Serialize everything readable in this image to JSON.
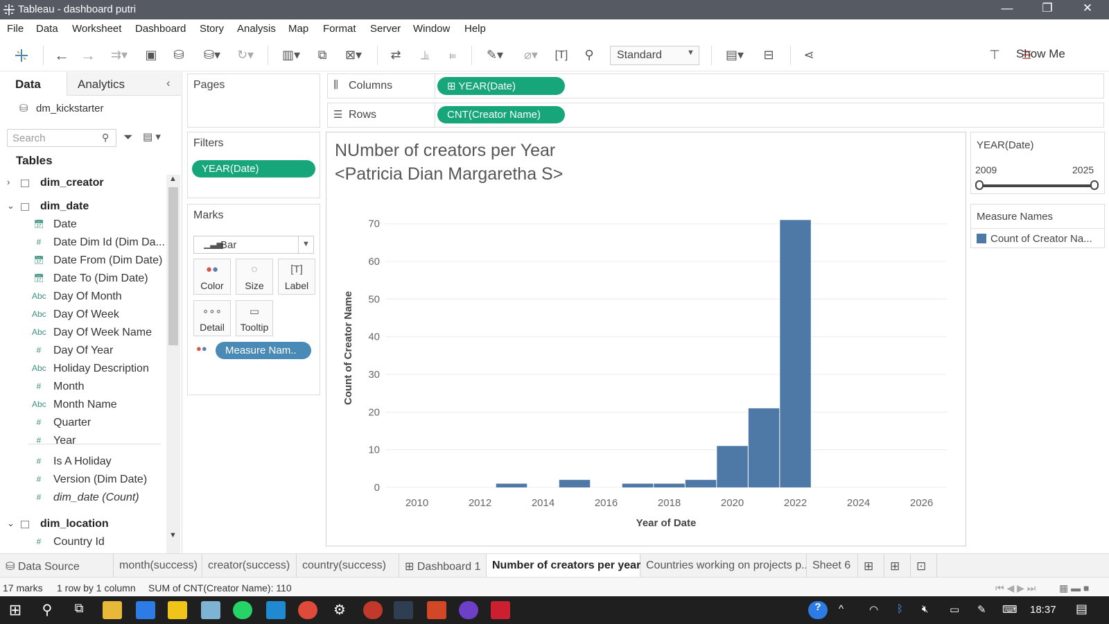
{
  "window": {
    "title": "Tableau - dashboard putri"
  },
  "menu": [
    "File",
    "Data",
    "Worksheet",
    "Dashboard",
    "Story",
    "Analysis",
    "Map",
    "Format",
    "Server",
    "Window",
    "Help"
  ],
  "toolbar": {
    "fit_mode": "Standard",
    "show_me": "Show Me"
  },
  "data_pane": {
    "tab_data": "Data",
    "tab_analytics": "Analytics",
    "datasource": "dm_kickstarter",
    "search_placeholder": "Search",
    "tables_heading": "Tables",
    "items": [
      {
        "kind": "table",
        "name": "dim_creator",
        "expanded": false
      },
      {
        "kind": "table",
        "name": "dim_date",
        "expanded": true
      },
      {
        "kind": "date",
        "name": "Date"
      },
      {
        "kind": "num",
        "name": "Date Dim Id (Dim Da..."
      },
      {
        "kind": "date",
        "name": "Date From (Dim Date)"
      },
      {
        "kind": "date",
        "name": "Date To (Dim Date)"
      },
      {
        "kind": "abc",
        "name": "Day Of Month"
      },
      {
        "kind": "abc",
        "name": "Day Of Week"
      },
      {
        "kind": "abc",
        "name": "Day Of Week Name"
      },
      {
        "kind": "num",
        "name": "Day Of Year"
      },
      {
        "kind": "abc",
        "name": "Holiday Description"
      },
      {
        "kind": "num",
        "name": "Month"
      },
      {
        "kind": "abc",
        "name": "Month Name"
      },
      {
        "kind": "num",
        "name": "Quarter"
      },
      {
        "kind": "num",
        "name": "Year"
      },
      {
        "kind": "num",
        "name": "Is A Holiday"
      },
      {
        "kind": "num",
        "name": "Version (Dim Date)"
      },
      {
        "kind": "num",
        "name": "dim_date (Count)",
        "italic": true
      },
      {
        "kind": "table",
        "name": "dim_location",
        "expanded": true
      },
      {
        "kind": "num",
        "name": "Country Id"
      }
    ]
  },
  "pages": {
    "label": "Pages"
  },
  "filters": {
    "label": "Filters",
    "pill": "YEAR(Date)"
  },
  "marks": {
    "label": "Marks",
    "type": "Bar",
    "buttons": [
      "Color",
      "Size",
      "Label",
      "Detail",
      "Tooltip"
    ],
    "pill": "Measure Nam.."
  },
  "shelves": {
    "columns_label": "Columns",
    "columns_pill": "YEAR(Date)",
    "rows_label": "Rows",
    "rows_pill": "CNT(Creator Name)"
  },
  "view": {
    "title_line1": "NUmber of creators per Year",
    "title_line2": "<Patricia Dian Margaretha S>"
  },
  "chart_data": {
    "type": "bar",
    "x": [
      2013,
      2015,
      2017,
      2018,
      2019,
      2020,
      2021,
      2022
    ],
    "values": [
      1,
      2,
      1,
      1,
      2,
      11,
      21,
      71
    ],
    "xlabel": "Year of Date",
    "ylabel": "Count of Creator Name",
    "xlim": [
      2009,
      2026.8
    ],
    "ylim": [
      0,
      74
    ],
    "xticks": [
      2010,
      2012,
      2014,
      2016,
      2018,
      2020,
      2022,
      2024,
      2026
    ],
    "yticks": [
      0,
      10,
      20,
      30,
      40,
      50,
      60,
      70
    ],
    "color": "#4e79a7",
    "grid": true
  },
  "year_filter": {
    "title": "YEAR(Date)",
    "min": "2009",
    "max": "2025"
  },
  "legend": {
    "title": "Measure Names",
    "item": "Count of Creator Na..."
  },
  "sheet_tabs": [
    "Data Source",
    "month(success)",
    "creator(success)",
    "country(success)",
    "Dashboard 1",
    "Number of creators per year",
    "Countries working on projects p...",
    "Sheet 6"
  ],
  "active_tab": "Number of creators per year",
  "status": {
    "marks": "17 marks",
    "rows": "1 row by 1 column",
    "sum": "SUM of CNT(Creator Name): 110"
  },
  "taskbar": {
    "time": "18:37"
  }
}
